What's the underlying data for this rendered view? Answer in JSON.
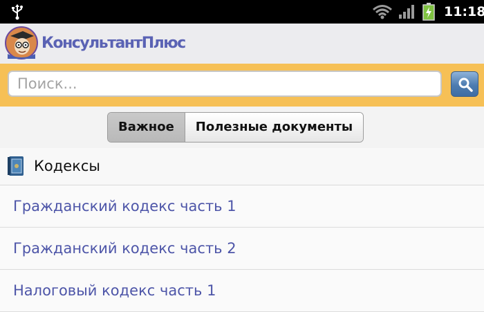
{
  "status_bar": {
    "time": "11:18",
    "icons": [
      "usb-icon",
      "wifi-icon",
      "signal-icon",
      "battery-charging-icon"
    ]
  },
  "app": {
    "logo_text": "КонсультантПлюс",
    "brand_color": "#5a62b4"
  },
  "search": {
    "placeholder": "Поиск...",
    "value": "",
    "button_icon": "search-icon",
    "bar_color": "#f6c056"
  },
  "tabs": [
    {
      "label": "Важное",
      "active": true
    },
    {
      "label": "Полезные документы",
      "active": false
    }
  ],
  "section": {
    "icon": "book-icon",
    "title": "Кодексы"
  },
  "list": {
    "items": [
      "Гражданский кодекс часть 1",
      "Гражданский кодекс часть 2",
      "Налоговый кодекс часть 1"
    ],
    "link_color": "#4d55a8"
  }
}
